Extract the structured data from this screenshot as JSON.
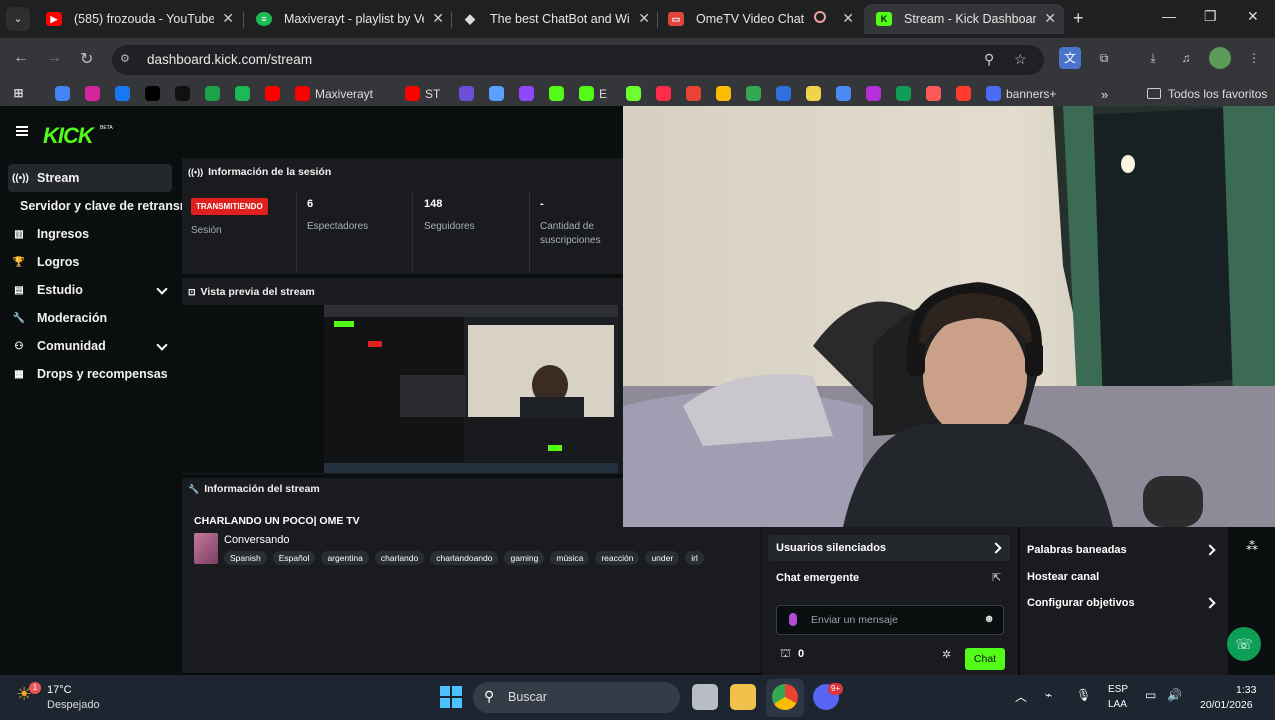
{
  "browser": {
    "tabs": [
      {
        "title": "(585) frozouda - YouTube",
        "icon": "youtube-icon",
        "color": "#ff0000"
      },
      {
        "title": "Maxiverayt - playlist by Vera",
        "icon": "spotify-icon",
        "color": "#1db954"
      },
      {
        "title": "The best ChatBot and Widge",
        "icon": "diamond-icon",
        "color": "#cccccc"
      },
      {
        "title": "OmeTV Video Chat — O",
        "icon": "ometv-icon",
        "color": "#e0443a"
      },
      {
        "title": "Stream - Kick Dashboard",
        "icon": "kick-icon",
        "color": "#53fc18",
        "active": true
      }
    ],
    "url": "dashboard.kick.com/stream",
    "bookmarks": [
      {
        "label": "",
        "icon": "google-icon",
        "color": "#4285f4"
      },
      {
        "label": "",
        "icon": "instagram-icon",
        "color": "#d6249f"
      },
      {
        "label": "",
        "icon": "facebook-icon",
        "color": "#1877f2"
      },
      {
        "label": "",
        "icon": "x-icon",
        "color": "#000000"
      },
      {
        "label": "",
        "icon": "tiktok-icon",
        "color": "#111111"
      },
      {
        "label": "",
        "icon": "app65-icon",
        "color": "#1aa34a"
      },
      {
        "label": "",
        "icon": "spotify-icon",
        "color": "#1db954"
      },
      {
        "label": "",
        "icon": "youtube-icon",
        "color": "#ff0000"
      },
      {
        "label": "Maxiverayt",
        "icon": "youtube-icon",
        "color": "#ff0000"
      },
      {
        "label": "ST",
        "icon": "youtube-icon",
        "color": "#ff0000"
      },
      {
        "label": "",
        "icon": "ring-icon",
        "color": "#6b4fd8"
      },
      {
        "label": "",
        "icon": "gemini-icon",
        "color": "#5aa0ff"
      },
      {
        "label": "",
        "icon": "twitch-icon",
        "color": "#9146ff"
      },
      {
        "label": "",
        "icon": "kick-icon",
        "color": "#53fc18"
      },
      {
        "label": "E",
        "icon": "kick-icon",
        "color": "#53fc18"
      },
      {
        "label": "",
        "icon": "d-icon",
        "color": "#6cff2f"
      },
      {
        "label": "",
        "icon": "record-icon",
        "color": "#ff2b4a"
      },
      {
        "label": "",
        "icon": "gmail-icon",
        "color": "#ea4335"
      },
      {
        "label": "",
        "icon": "drive-icon",
        "color": "#fbbc04"
      },
      {
        "label": "",
        "icon": "maps-icon",
        "color": "#34a853"
      },
      {
        "label": "",
        "icon": "docs-icon",
        "color": "#2f6fde"
      },
      {
        "label": "",
        "icon": "chip-icon",
        "color": "#f0d34a"
      },
      {
        "label": "",
        "icon": "translate-icon",
        "color": "#4a8af4"
      },
      {
        "label": "",
        "icon": "picsart-icon",
        "color": "#b530d8"
      },
      {
        "label": "",
        "icon": "sheets-icon",
        "color": "#0f9d58"
      },
      {
        "label": "",
        "icon": "soundwave-icon",
        "color": "#ff5a5a"
      },
      {
        "label": "",
        "icon": "download-icon",
        "color": "#ff3b30"
      },
      {
        "label": "banners+",
        "icon": "banner-icon",
        "color": "#4a6cf7"
      }
    ],
    "all_bookmarks": "Todos los favoritos"
  },
  "sidebar": {
    "items": [
      {
        "label": "Stream",
        "icon": "broadcast-icon",
        "active": true
      },
      {
        "label": "Servidor y clave de retransmisión",
        "icon": "",
        "active": false
      },
      {
        "label": "Ingresos",
        "icon": "earnings-icon",
        "active": false
      },
      {
        "label": "Logros",
        "icon": "trophy-icon",
        "active": false
      },
      {
        "label": "Estudio",
        "icon": "studio-icon",
        "active": false,
        "expandable": true
      },
      {
        "label": "Moderación",
        "icon": "wrench-icon",
        "active": false
      },
      {
        "label": "Comunidad",
        "icon": "community-icon",
        "active": false,
        "expandable": true
      },
      {
        "label": "Drops y recompensas",
        "icon": "drops-icon",
        "active": false
      }
    ]
  },
  "session": {
    "heading": "Información de la sesión",
    "live_badge": "TRANSMITIENDO",
    "session_label": "Sesión",
    "viewers_value": "6",
    "viewers_label": "Espectadores",
    "followers_value": "148",
    "followers_label": "Seguidores",
    "subs_value": "-",
    "subs_label": "Cantidad de suscripciones"
  },
  "preview": {
    "heading": "Vista previa del stream"
  },
  "stream_info": {
    "heading": "Información del stream",
    "title": "CHARLANDO UN POCO| OME TV",
    "category": "Conversando",
    "tags": [
      "Spanish",
      "Español",
      "argentina",
      "charlando",
      "charlandoando",
      "gaming",
      "música",
      "reacción",
      "under",
      "irl"
    ]
  },
  "chat_menu": {
    "silenced_users": "Usuarios silenciados",
    "popup_chat": "Chat emergente",
    "banned_words": "Palabras baneadas",
    "host_channel": "Hostear canal",
    "configure_goals": "Configurar objetivos",
    "message_placeholder": "Enviar un mensaje",
    "points": "0",
    "chat_button": "Chat"
  },
  "taskbar": {
    "weather_temp": "17°C",
    "weather_desc": "Despejado",
    "weather_badge": "1",
    "search_label": "Buscar",
    "discord_badge": "9+",
    "lang_top": "ESP",
    "lang_bottom": "LAA",
    "time": "1:33",
    "date": "20/01/2026"
  }
}
